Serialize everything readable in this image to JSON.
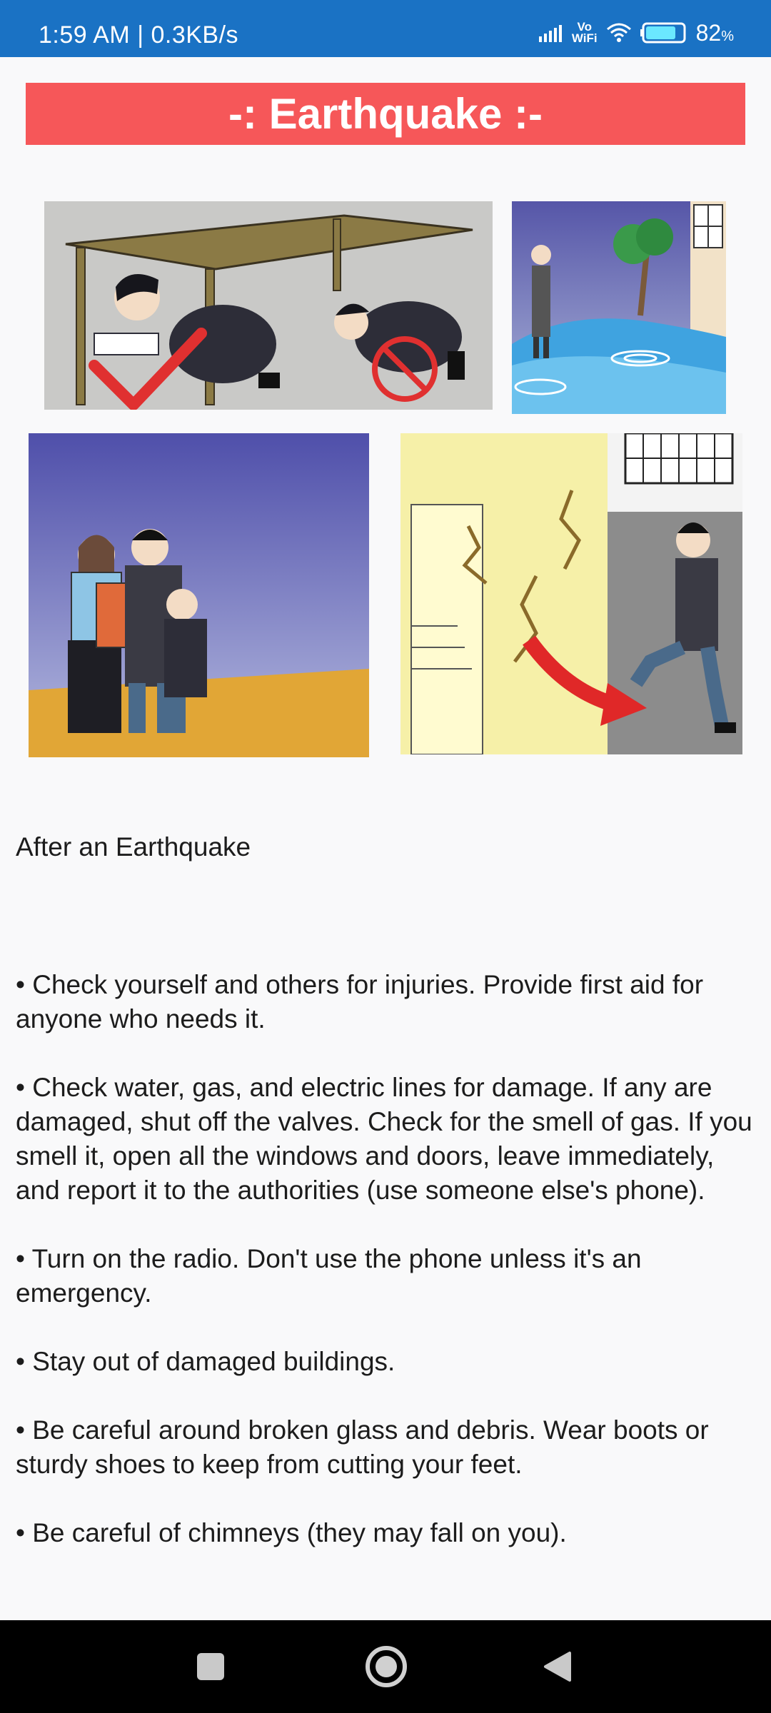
{
  "status_bar": {
    "time": "1:59 AM | 0.3KB/s",
    "network_label_top": "Vo",
    "network_label_bottom": "WiFi",
    "battery_percent": "82",
    "battery_percent_sign": "%",
    "battery_level": 0.82
  },
  "header": {
    "title": "-: Earthquake :-",
    "color": "#f65759"
  },
  "illustrations": [
    {
      "name": "take-cover-under-table-illustration"
    },
    {
      "name": "standing-in-water-illustration"
    },
    {
      "name": "helping-injured-illustration"
    },
    {
      "name": "running-from-cracked-building-illustration"
    }
  ],
  "content": {
    "subtitle": "After an Earthquake",
    "bullets": [
      "• Check yourself and others for injuries. Provide first aid for anyone who needs it.",
      "• Check water, gas, and electric lines for damage. If any are damaged, shut off the valves. Check for the smell of gas. If you smell it, open all the windows and doors, leave immediately, and report it to the authorities (use someone else's phone).",
      "• Turn on the radio. Don't use the phone unless it's an emergency.",
      "• Stay out of damaged buildings.",
      "• Be careful around broken glass and debris. Wear boots or sturdy shoes to keep from cutting your feet.",
      "• Be careful of chimneys (they may fall on you)."
    ]
  },
  "colors": {
    "status_bar": "#1a72c4",
    "background": "#f9f9fa",
    "nav_bar": "#000000"
  },
  "nav_bar": {
    "buttons": [
      "recent-apps-icon",
      "home-icon",
      "back-icon"
    ]
  }
}
